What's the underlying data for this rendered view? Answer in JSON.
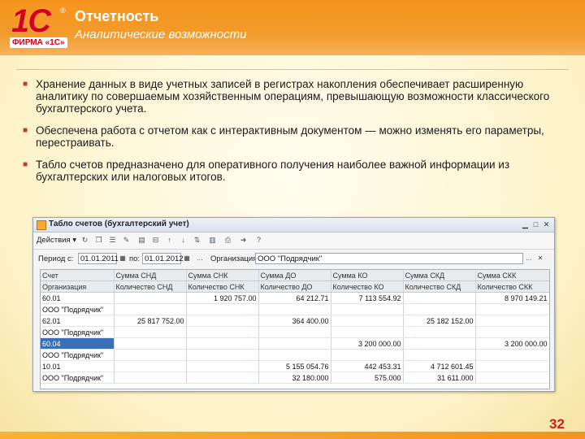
{
  "header": {
    "logo_text": "1С",
    "logo_reg": "®",
    "logo_caption": "ФИРМА «1С»",
    "title": "Отчетность",
    "subtitle": "Аналитические возможности"
  },
  "bullets": [
    "Хранение данных в виде учетных записей в регистрах накопления обеспечивает расширенную аналитику по совершаемым хозяйственным операциям, превышающую возможности классического бухгалтерского учета.",
    "Обеспечена работа с отчетом как с интерактивным документом — можно изменять его параметры, перестраивать.",
    "Табло счетов предназначено для оперативного получения наиболее важной информации из бухгалтерских или налоговых итогов."
  ],
  "window": {
    "title": "Табло счетов (бухгалтерский учет)",
    "toolbar": {
      "actions_label": "Действия ▾"
    },
    "params": {
      "period_label": "Период с:",
      "period_from": "01.01.2011",
      "to_label": "по:",
      "period_to": "01.01.2012",
      "org_label": "Организация:",
      "org_value": "ООО \"Подрядчик\""
    },
    "grid": {
      "header1": [
        "Счет",
        "Сумма СНД",
        "Сумма СНК",
        "Сумма ДО",
        "Сумма КО",
        "Сумма СКД",
        "Сумма СКК"
      ],
      "header2": [
        "Организация",
        "Количество СНД",
        "Количество СНК",
        "Количество ДО",
        "Количество КО",
        "Количество СКД",
        "Количество СКК"
      ],
      "rows": [
        [
          "60.01",
          "",
          "1 920 757.00",
          "64 212.71",
          "7 113 554.92",
          "",
          "8 970 149.21"
        ],
        [
          "ООО \"Подрядчик\"",
          "",
          "",
          "",
          "",
          "",
          ""
        ],
        [
          "62.01",
          "25 817 752.00",
          "",
          "364 400.00",
          "",
          "25 182 152.00",
          ""
        ],
        [
          "ООО \"Подрядчик\"",
          "",
          "",
          "",
          "",
          "",
          ""
        ],
        [
          "60.04",
          "",
          "",
          "",
          "3 200 000.00",
          "",
          "3 200 000.00"
        ],
        [
          "ООО \"Подрядчик\"",
          "",
          "",
          "",
          "",
          "",
          ""
        ],
        [
          "10.01",
          "",
          "",
          "5 155 054.76",
          "442 453.31",
          "4 712 601.45",
          ""
        ],
        [
          "ООО \"Подрядчик\"",
          "",
          "",
          "32 180.000",
          "575.000",
          "31 611.000",
          ""
        ]
      ],
      "selected_row": 4
    }
  },
  "page_number": "32",
  "colors": {
    "accent": "#f7941d",
    "brand_red": "#d6001c",
    "selection": "#3a6fb5"
  }
}
